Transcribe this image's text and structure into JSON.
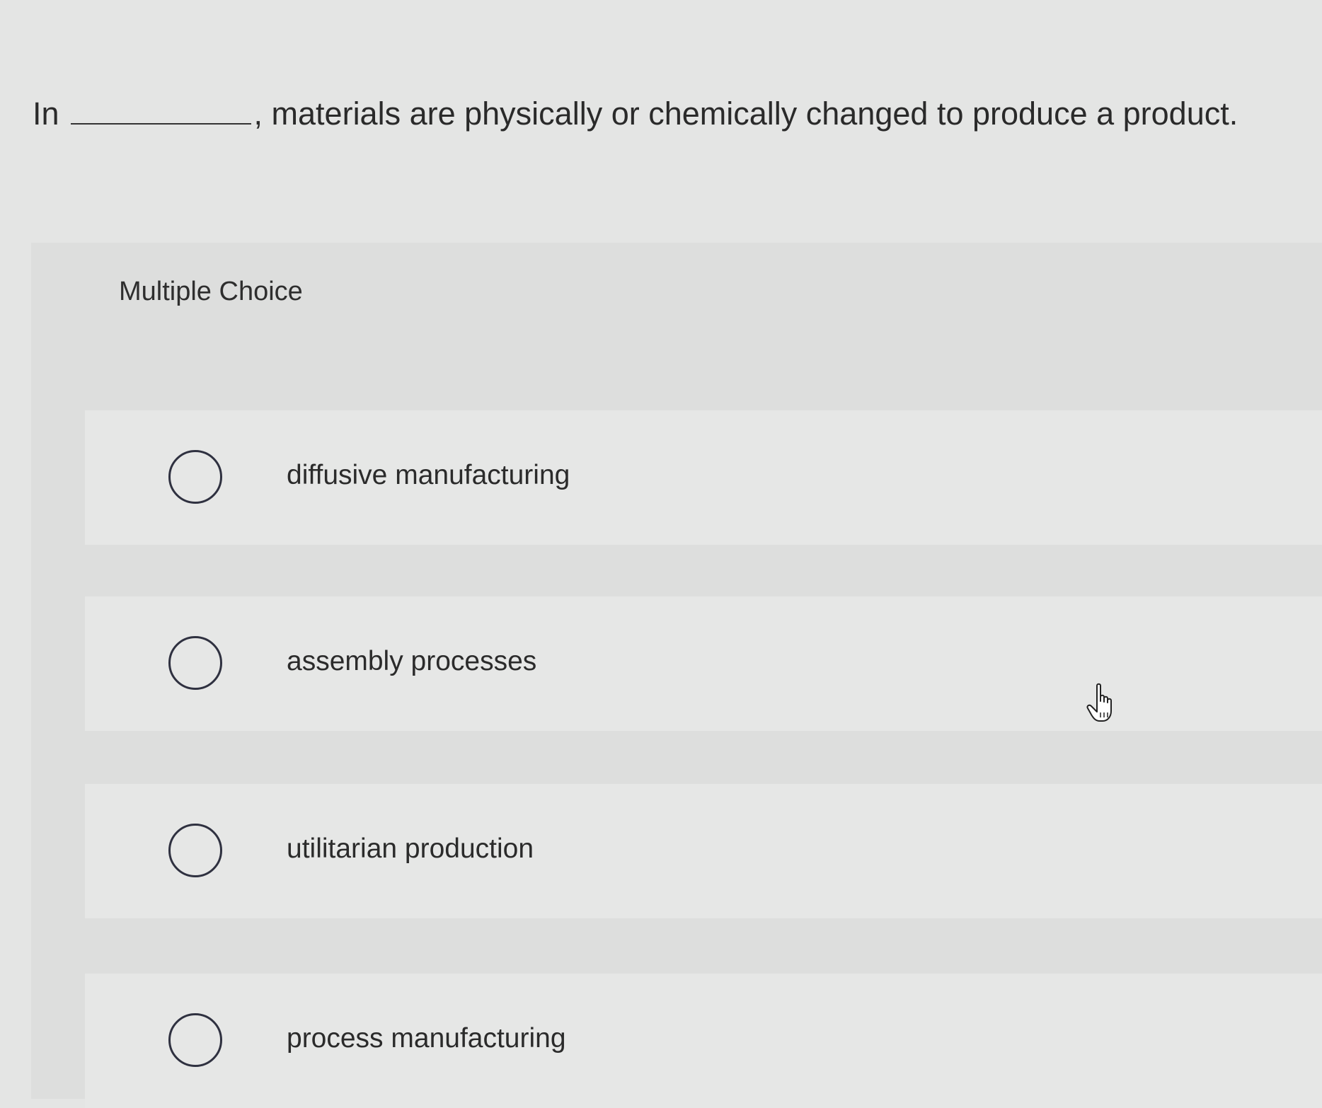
{
  "question": {
    "prefix": "In",
    "suffix": ", materials are physically or chemically changed to produce a product."
  },
  "section": {
    "header": "Multiple Choice"
  },
  "options": [
    {
      "label": "diffusive manufacturing",
      "selected": false
    },
    {
      "label": "assembly processes",
      "selected": false
    },
    {
      "label": "utilitarian production",
      "selected": false
    },
    {
      "label": "process manufacturing",
      "selected": false
    }
  ],
  "cursor": {
    "icon": "hand-pointer-icon"
  },
  "colors": {
    "background": "#e4e5e4",
    "panel": "#dddedd",
    "option_row": "#e6e7e6",
    "radio_border": "#2f3140",
    "text": "#2b2b2b"
  }
}
